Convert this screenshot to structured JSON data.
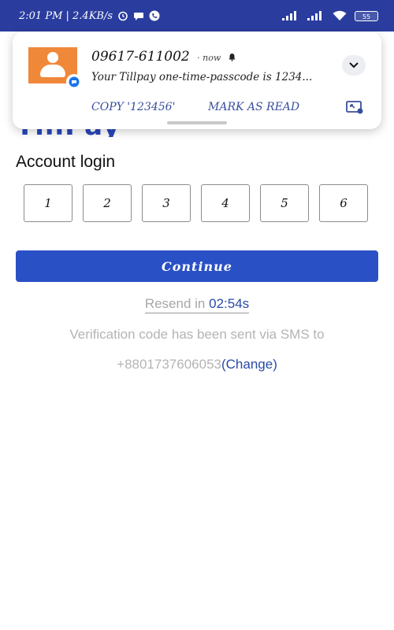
{
  "status_bar": {
    "time_speed": "2:01 PM | 2.4KB/s",
    "battery": "55",
    "bg_color": "#2a3d9e"
  },
  "app": {
    "logo_text": "TillPay"
  },
  "notification": {
    "sender": "09617-611002",
    "time": "· now",
    "message": "Your Tillpay one-time-passcode is 1234...",
    "copy_action": "COPY '123456'",
    "read_action": "MARK AS READ",
    "avatar_color": "#f0883a"
  },
  "login": {
    "title": "Account login",
    "otp_digits": [
      "1",
      "2",
      "3",
      "4",
      "5",
      "6"
    ],
    "continue_label": "Continue",
    "resend_label": "Resend in ",
    "resend_timer": "02:54s",
    "info_text": "Verification code has been sent via SMS to",
    "phone": "+8801737606053",
    "change_label": "(Change)",
    "accent_color": "#2a50c5"
  }
}
